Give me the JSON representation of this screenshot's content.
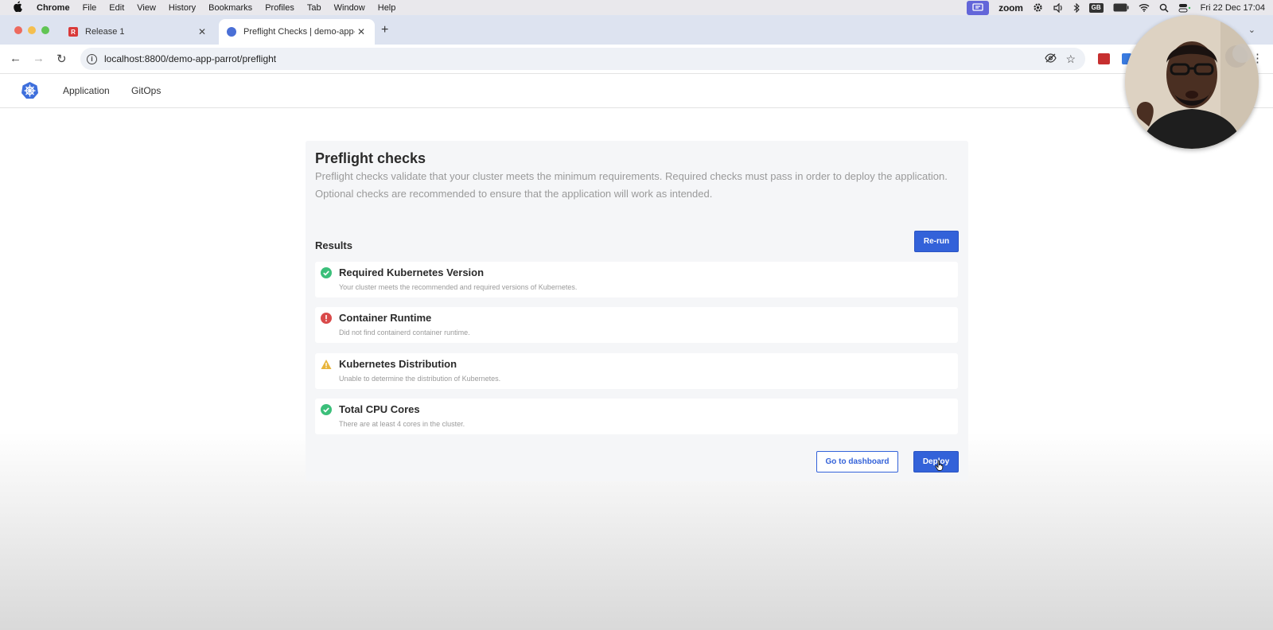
{
  "menubar": {
    "app": "Chrome",
    "items": [
      "File",
      "Edit",
      "View",
      "History",
      "Bookmarks",
      "Profiles",
      "Tab",
      "Window",
      "Help"
    ],
    "zoom": "zoom",
    "lang_badge": "GB",
    "datetime": "Fri 22 Dec  17:04"
  },
  "tabs": [
    {
      "title": "Release 1",
      "favicon_color": "#d93a3a",
      "favicon_letter": "R"
    },
    {
      "title": "Preflight Checks | demo-app-",
      "favicon_color": "#4a6fd6"
    }
  ],
  "toolbar": {
    "url": "localhost:8800/demo-app-parrot/preflight"
  },
  "appnav": {
    "links": [
      "Application",
      "GitOps"
    ]
  },
  "preflight": {
    "title": "Preflight checks",
    "description": "Preflight checks validate that your cluster meets the minimum requirements. Required checks must pass in order to deploy the application. Optional checks are recommended to ensure that the application will work as intended.",
    "results_label": "Results",
    "rerun_label": "Re-run",
    "checks": [
      {
        "title": "Required Kubernetes Version",
        "message": "Your cluster meets the recommended and required versions of Kubernetes.",
        "status": "pass"
      },
      {
        "title": "Container Runtime",
        "message": "Did not find containerd container runtime.",
        "status": "fail"
      },
      {
        "title": "Kubernetes Distribution",
        "message": "Unable to determine the distribution of Kubernetes.",
        "status": "warn"
      },
      {
        "title": "Total CPU Cores",
        "message": "There are at least 4 cores in the cluster.",
        "status": "pass"
      }
    ],
    "dashboard_label": "Go to dashboard",
    "deploy_label": "Deploy"
  },
  "colors": {
    "accent": "#3362d9",
    "pass": "#3bbf7a",
    "fail": "#d94a4a",
    "warn": "#e8b43a"
  }
}
